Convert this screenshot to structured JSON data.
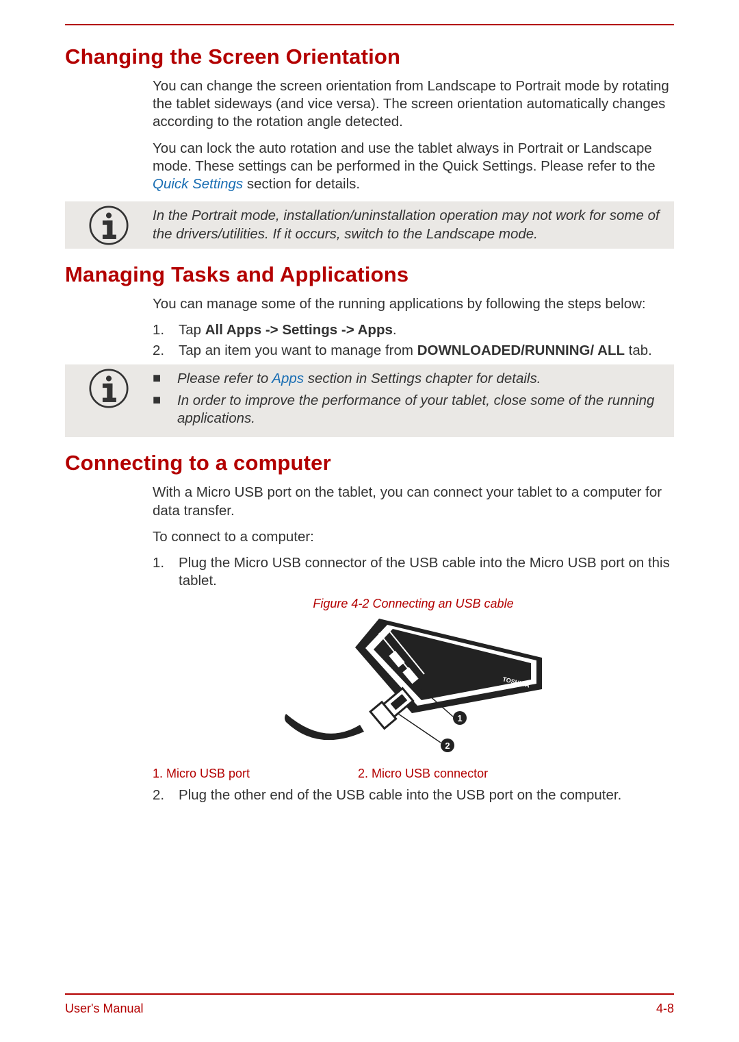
{
  "headings": {
    "h1": "Changing the Screen Orientation",
    "h2": "Managing Tasks and Applications",
    "h3": "Connecting to a computer"
  },
  "section1": {
    "p1": "You can change the screen orientation from Landscape to Portrait mode by rotating the tablet sideways (and vice versa). The screen orientation automatically changes according to the rotation angle detected.",
    "p2a": "You can lock the auto rotation and use the tablet always in Portrait or Landscape mode. These settings can be performed in the Quick Settings. Please refer to the ",
    "p2link": "Quick Settings",
    "p2b": " section for details.",
    "note": "In the Portrait mode, installation/uninstallation operation may not work for some of the drivers/utilities. If it occurs, switch to the Landscape mode."
  },
  "section2": {
    "p1": "You can manage some of the running applications by following the steps below:",
    "li1_a": "Tap ",
    "li1_b": "All Apps -> Settings -> Apps",
    "li1_c": ".",
    "li2_a": "Tap an item you want to manage from ",
    "li2_b": "DOWNLOADED/RUNNING/ ALL",
    "li2_c": " tab.",
    "noteb1_a": "Please refer to ",
    "noteb1_link": "Apps",
    "noteb1_b": " section in Settings chapter for details.",
    "noteb2": "In order to improve the performance of your tablet, close some of the running applications."
  },
  "section3": {
    "p1": "With a Micro USB port on the tablet, you can connect your tablet to a computer for data transfer.",
    "p2": "To connect to a computer:",
    "li1": "Plug the Micro USB connector of the USB cable into the Micro USB port on this tablet.",
    "figcaption": "Figure 4-2 Connecting an USB cable",
    "key1": "1. Micro USB port",
    "key2": "2. Micro USB connector",
    "li2": "Plug the other end of the USB cable into the USB port on the computer."
  },
  "callouts": {
    "c1": "1",
    "c2": "2"
  },
  "brand": "TOSHIBA",
  "list_markers": {
    "n1": "1.",
    "n2": "2.",
    "bullet": "■"
  },
  "footer": {
    "left": "User's Manual",
    "right": "4-8"
  }
}
